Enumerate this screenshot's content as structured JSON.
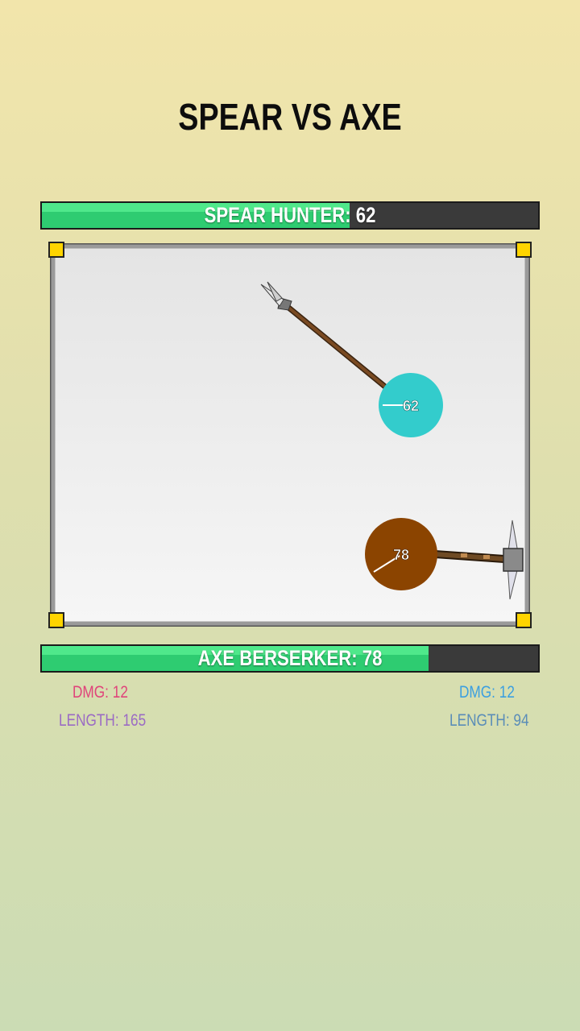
{
  "title": "SPEAR VS AXE",
  "fighters": {
    "top": {
      "label": "SPEAR HUNTER: 62",
      "hp": 62,
      "hp_fraction": 0.62,
      "color": "#33cccc",
      "ball_text": "62"
    },
    "bottom": {
      "label": "AXE BERSERKER: 78",
      "hp": 78,
      "hp_fraction": 0.78,
      "color": "#8b4400",
      "ball_text": "78"
    }
  },
  "stats": {
    "left": {
      "dmg": "DMG: 12",
      "length": "LENGTH: 165"
    },
    "right": {
      "dmg": "DMG: 12",
      "length": "LENGTH: 94"
    }
  },
  "colors": {
    "hp_fill": "#2ecc71",
    "hp_empty": "#3a3a3a",
    "arena_frame": "#7a7a7a",
    "corner_marker": "#ffd400"
  }
}
